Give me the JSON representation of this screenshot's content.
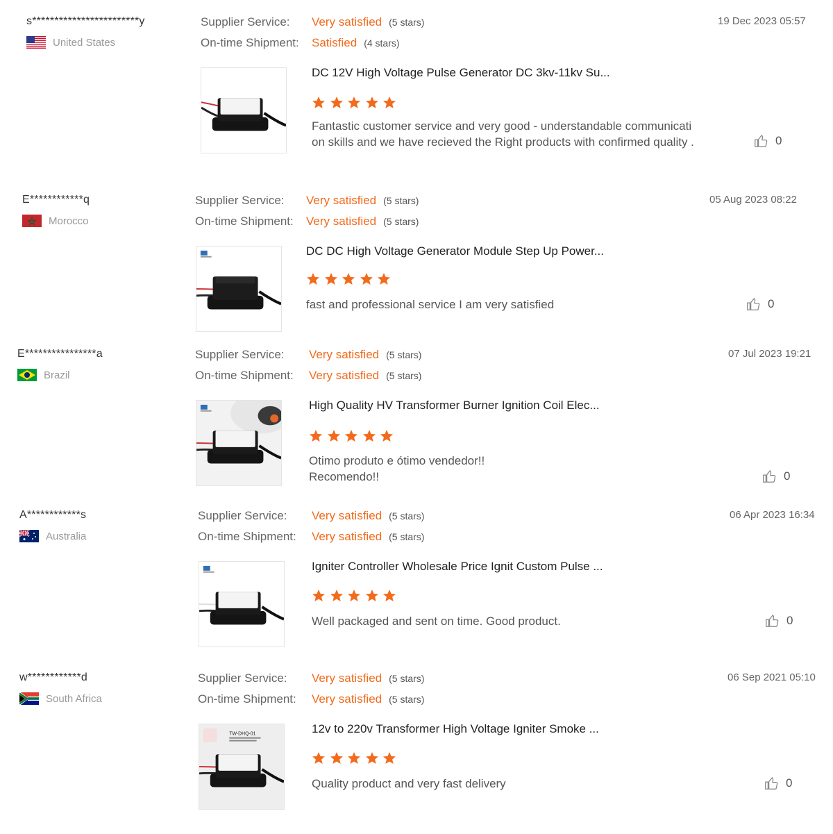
{
  "labels": {
    "supplier_service": "Supplier Service:",
    "shipment": "On-time Shipment:"
  },
  "colors": {
    "accent": "#f26b1d",
    "star": "#f26b1d"
  },
  "reviews": [
    {
      "reviewer": "s************************y",
      "country": "United States",
      "flag": "us",
      "supplier_rating": "Very satisfied",
      "supplier_stars": "(5 stars)",
      "shipment_rating": "Satisfied",
      "shipment_stars": "(4 stars)",
      "date": "19 Dec 2023 05:57",
      "product_title": "DC 12V High Voltage Pulse Generator DC 3kv-11kv Su...",
      "rating": 5,
      "comment": [
        "Fantastic customer service and very good - understandable communicati",
        "on skills and we have recieved the Right products with confirmed quality ."
      ],
      "helpful": "0",
      "thumb_icon": "pulse-generator-image"
    },
    {
      "reviewer": "E************q",
      "country": "Morocco",
      "flag": "ma",
      "supplier_rating": "Very satisfied",
      "supplier_stars": "(5 stars)",
      "shipment_rating": "Very satisfied",
      "shipment_stars": "(5 stars)",
      "date": "05 Aug 2023 08:22",
      "product_title": "DC DC High Voltage Generator Module Step Up Power...",
      "rating": 5,
      "comment": [
        "fast and professional service I am very satisfied"
      ],
      "helpful": "0",
      "thumb_icon": "generator-module-image"
    },
    {
      "reviewer": "E****************a",
      "country": "Brazil",
      "flag": "br",
      "supplier_rating": "Very satisfied",
      "supplier_stars": "(5 stars)",
      "shipment_rating": "Very satisfied",
      "shipment_stars": "(5 stars)",
      "date": "07 Jul 2023 19:21",
      "product_title": "High Quality HV Transformer Burner Ignition Coil Elec...",
      "rating": 5,
      "comment": [
        "Otimo produto e ótimo vendedor!!",
        "Recomendo!!"
      ],
      "helpful": "0",
      "thumb_icon": "ignition-coil-image"
    },
    {
      "reviewer": "A************s",
      "country": "Australia",
      "flag": "au",
      "supplier_rating": "Very satisfied",
      "supplier_stars": "(5 stars)",
      "shipment_rating": "Very satisfied",
      "shipment_stars": "(5 stars)",
      "date": "06 Apr 2023 16:34",
      "product_title": "Igniter Controller Wholesale Price Ignit Custom Pulse ...",
      "rating": 5,
      "comment": [
        "Well packaged and sent on time. Good product."
      ],
      "helpful": "0",
      "thumb_icon": "igniter-controller-image"
    },
    {
      "reviewer": "w************d",
      "country": "South Africa",
      "flag": "za",
      "supplier_rating": "Very satisfied",
      "supplier_stars": "(5 stars)",
      "shipment_rating": "Very satisfied",
      "shipment_stars": "(5 stars)",
      "date": "06 Sep 2021 05:10",
      "product_title": "12v to 220v Transformer High Voltage Igniter Smoke ...",
      "rating": 5,
      "comment": [
        "Quality product and very fast delivery"
      ],
      "helpful": "0",
      "thumb_icon": "transformer-igniter-image",
      "thumb_text": [
        "TW-DHQ-01"
      ]
    }
  ]
}
